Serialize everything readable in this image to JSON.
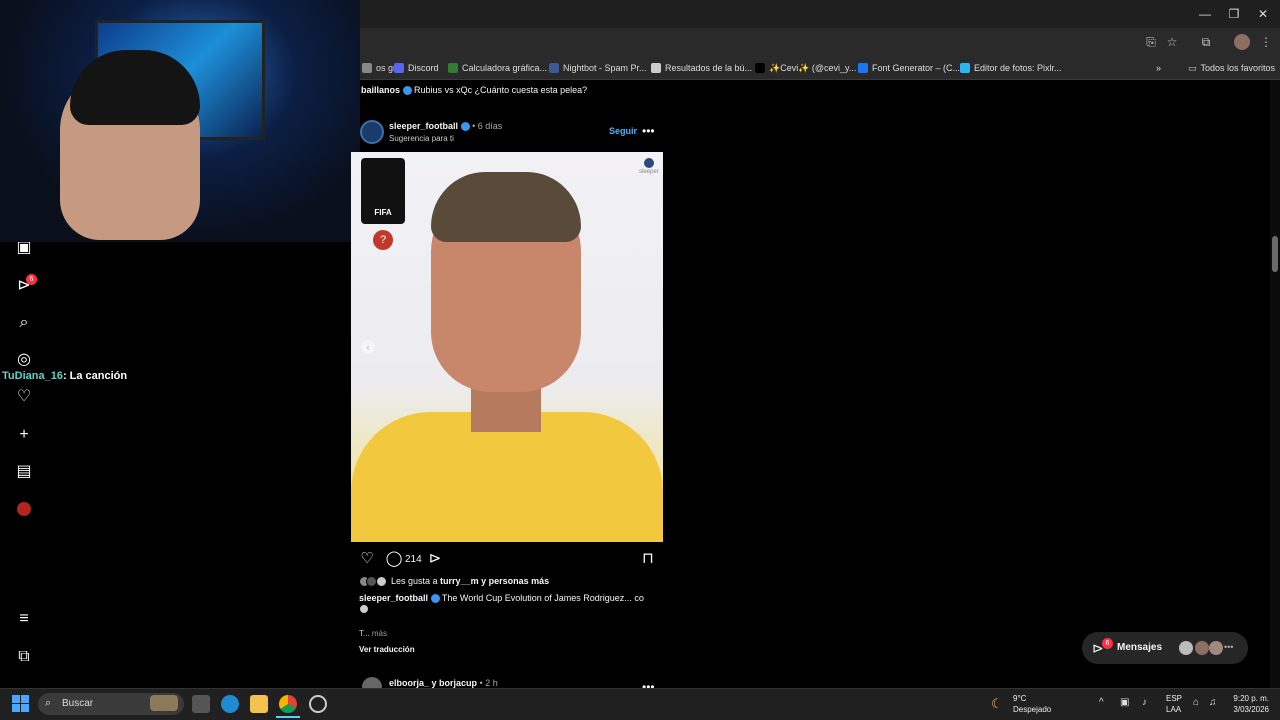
{
  "browser": {
    "bookmarks": [
      {
        "label": "os gr...",
        "color": "#888888"
      },
      {
        "label": "Discord",
        "color": "#5865F2"
      },
      {
        "label": "Calculadora gráfica...",
        "color": "#2e7d32"
      },
      {
        "label": "Nightbot - Spam Pr...",
        "color": "#3b5998"
      },
      {
        "label": "Resultados de la bú...",
        "color": "#cccccc"
      },
      {
        "label": "✨Cevi✨ (@cevi_y...",
        "color": "#000000"
      },
      {
        "label": "Font Generator – (C...",
        "color": "#1877f2"
      },
      {
        "label": "Editor de fotos: Pixlr...",
        "color": "#29b6f6"
      }
    ],
    "all_favorites": "Todos los favoritos",
    "more_bookmarks": "»"
  },
  "nav": {
    "notifications_badge": "6"
  },
  "chat": {
    "user": "TuDiana_16",
    "message": ": La canción"
  },
  "feed": {
    "prev_caption_user": "baillanos",
    "prev_caption_text": "Rubius vs xQc ¿Cuánto cuesta esta pelea?",
    "post": {
      "username": "sleeper_football",
      "time": "• 6 días",
      "suggestion": "Sugerencia para ti",
      "follow_label": "Seguir",
      "more": "•••",
      "badge_text": "FIFA",
      "watermark": "sleeper",
      "comments_count": "214",
      "likes_prefix": "Les gusta a ",
      "likes_user": "turry__m",
      "likes_suffix": " y personas más",
      "caption_user": "sleeper_football",
      "caption_text": "The World Cup Evolution of James Rodriguez... co",
      "caption_more_prefix": "T... ",
      "caption_more": "más",
      "translate": "Ver traducción"
    },
    "next_post": {
      "username": "elboorja_ y borjacup",
      "time": "• 2 h"
    }
  },
  "messages": {
    "label": "Mensajes",
    "badge": "6",
    "avatar_colors": [
      "#bbbbbb",
      "#8d6e63",
      "#a1887f"
    ]
  },
  "taskbar": {
    "search_label": "Buscar",
    "weather_temp": "9°C",
    "weather_desc": "Despejado",
    "lang_top": "ESP",
    "lang_bottom": "LAA",
    "time": "9:20 p. m.",
    "date": "3/03/2026"
  }
}
